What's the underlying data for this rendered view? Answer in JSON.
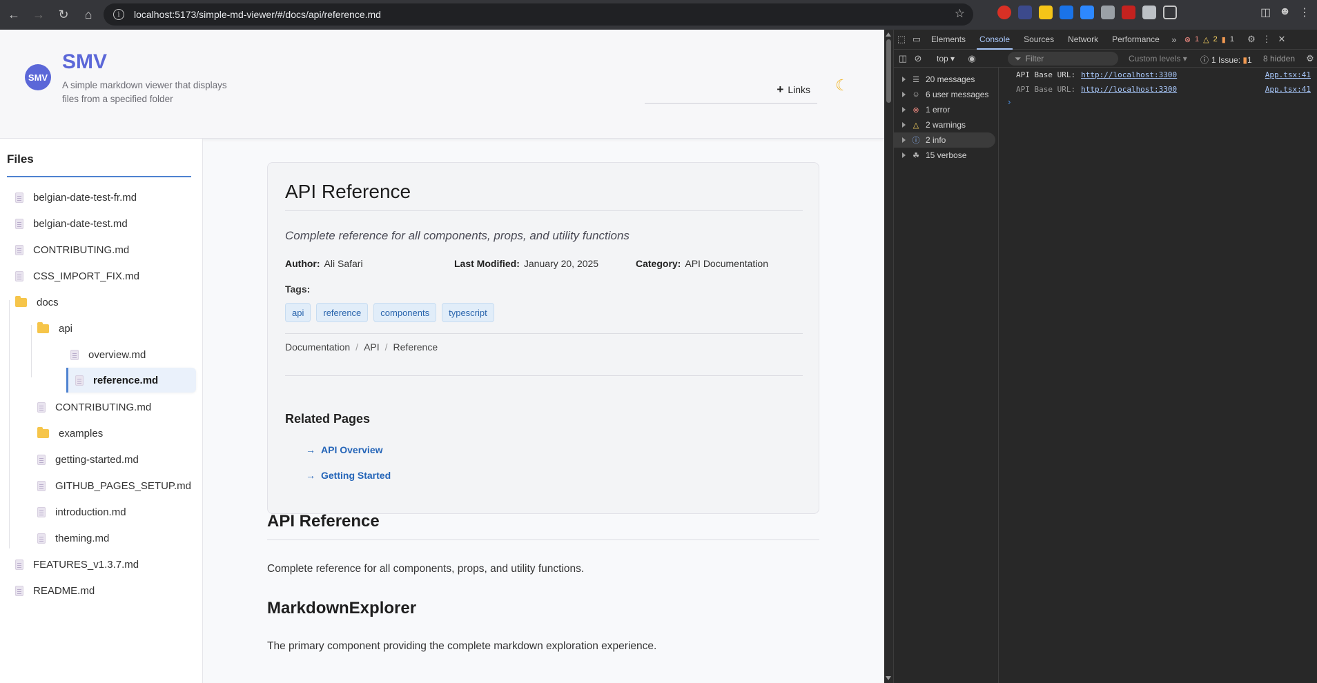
{
  "browser": {
    "url": "localhost:5173/simple-md-viewer/#/docs/api/reference.md"
  },
  "app": {
    "logo_text": "SMV",
    "title": "SMV",
    "subtitle": "A simple markdown viewer that displays files from a specified folder",
    "links_label": "Links"
  },
  "sidebar": {
    "title": "Files",
    "items": [
      {
        "label": "belgian-date-test-fr.md",
        "type": "file"
      },
      {
        "label": "belgian-date-test.md",
        "type": "file"
      },
      {
        "label": "CONTRIBUTING.md",
        "type": "file"
      },
      {
        "label": "CSS_IMPORT_FIX.md",
        "type": "file"
      },
      {
        "label": "docs",
        "type": "folder"
      },
      {
        "label": "api",
        "type": "folder"
      },
      {
        "label": "overview.md",
        "type": "file"
      },
      {
        "label": "reference.md",
        "type": "file",
        "active": true
      },
      {
        "label": "CONTRIBUTING.md",
        "type": "file"
      },
      {
        "label": "examples",
        "type": "folder"
      },
      {
        "label": "getting-started.md",
        "type": "file"
      },
      {
        "label": "GITHUB_PAGES_SETUP.md",
        "type": "file"
      },
      {
        "label": "introduction.md",
        "type": "file"
      },
      {
        "label": "theming.md",
        "type": "file"
      },
      {
        "label": "FEATURES_v1.3.7.md",
        "type": "file"
      },
      {
        "label": "README.md",
        "type": "file"
      }
    ]
  },
  "card": {
    "title": "API Reference",
    "description": "Complete reference for all components, props, and utility functions",
    "author_label": "Author:",
    "author": "Ali Safari",
    "modified_label": "Last Modified:",
    "modified": "January 20, 2025",
    "category_label": "Category:",
    "category": "API Documentation",
    "tags_label": "Tags:",
    "tags": [
      "api",
      "reference",
      "components",
      "typescript"
    ],
    "breadcrumbs": [
      "Documentation",
      "API",
      "Reference"
    ],
    "related_title": "Related Pages",
    "related": [
      "API Overview",
      "Getting Started"
    ]
  },
  "content": {
    "h1": "API Reference",
    "intro": "Complete reference for all components, props, and utility functions.",
    "h2": "MarkdownExplorer",
    "h2_text": "The primary component providing the complete markdown exploration experience."
  },
  "devtools": {
    "tabs": [
      "Elements",
      "Console",
      "Sources",
      "Network",
      "Performance"
    ],
    "active_tab": "Console",
    "error_count": "1",
    "warning_count": "2",
    "issue_count": "1",
    "context": "top",
    "filter_placeholder": "Filter",
    "levels": "Custom levels",
    "issues_label": "1 Issue:",
    "issues_count": "1",
    "hidden": "8 hidden",
    "sidebar": [
      {
        "label": "20 messages",
        "icon": "list-icon"
      },
      {
        "label": "6 user messages",
        "icon": "user-icon"
      },
      {
        "label": "1 error",
        "icon": "error-icon"
      },
      {
        "label": "2 warnings",
        "icon": "warning-icon"
      },
      {
        "label": "2 info",
        "icon": "info-icon"
      },
      {
        "label": "15 verbose",
        "icon": "bug-icon"
      }
    ],
    "logs": [
      {
        "text": "API Base URL:",
        "link": "http://localhost:3300",
        "src": "App.tsx:41"
      },
      {
        "text": "API Base URL:",
        "link": "http://localhost:3300",
        "src": "App.tsx:41"
      }
    ]
  }
}
